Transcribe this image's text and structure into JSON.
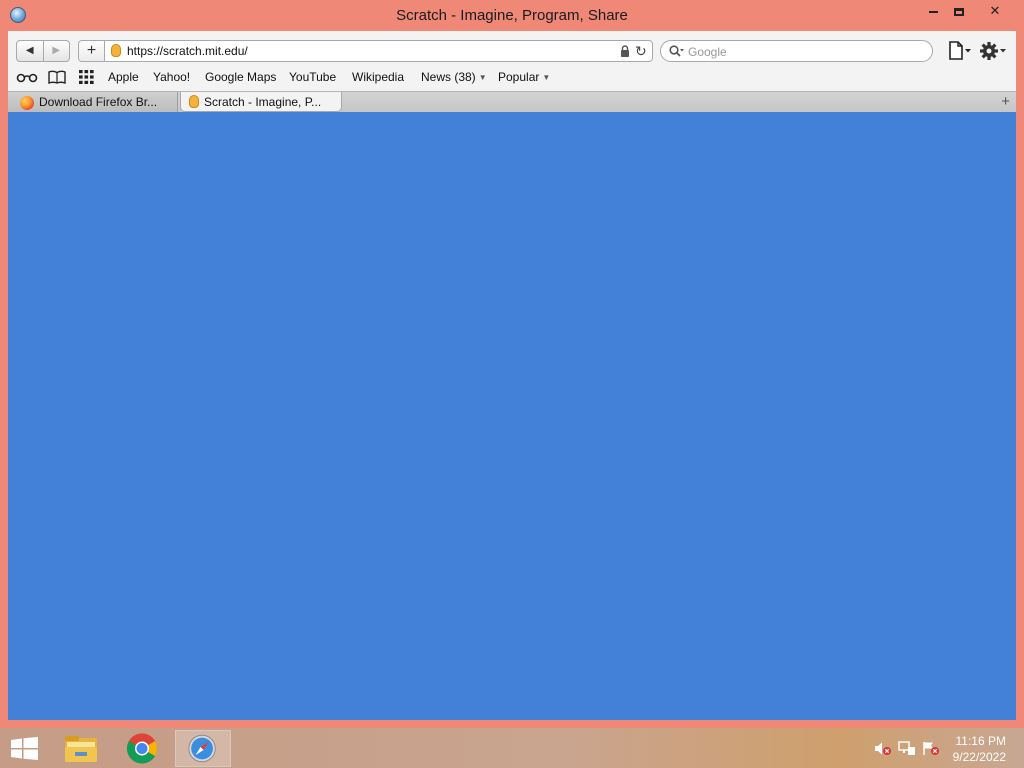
{
  "window": {
    "title": "Scratch - Imagine, Program, Share",
    "minimize_label": "minimize",
    "maximize_label": "maximize",
    "close_glyph": "✕"
  },
  "toolbar": {
    "back_glyph": "◀",
    "forward_glyph": "▶",
    "add_glyph": "+",
    "url": "https://scratch.mit.edu/",
    "reload_glyph": "↻",
    "search_placeholder": "Google"
  },
  "bookmarks": {
    "items": [
      {
        "label": "Apple"
      },
      {
        "label": "Yahoo!"
      },
      {
        "label": "Google Maps"
      },
      {
        "label": "YouTube"
      },
      {
        "label": "Wikipedia"
      },
      {
        "label": "News (38)"
      },
      {
        "label": "Popular"
      }
    ],
    "arrow_glyph": "▼"
  },
  "tabs": [
    {
      "label": "Download Firefox Br...",
      "icon": "firefox-icon",
      "active": false
    },
    {
      "label": "Scratch - Imagine, P...",
      "icon": "scratch-favicon",
      "active": true
    }
  ],
  "new_tab_glyph": "+",
  "content": {
    "background": "#4381d8"
  },
  "taskbar": {
    "apps": [
      "file-explorer-icon",
      "chrome-icon",
      "safari-icon"
    ],
    "clock": {
      "time": "11:16 PM",
      "date": "9/22/2022"
    }
  },
  "colors": {
    "frame": "#f08878",
    "accent": "#4381d8"
  }
}
